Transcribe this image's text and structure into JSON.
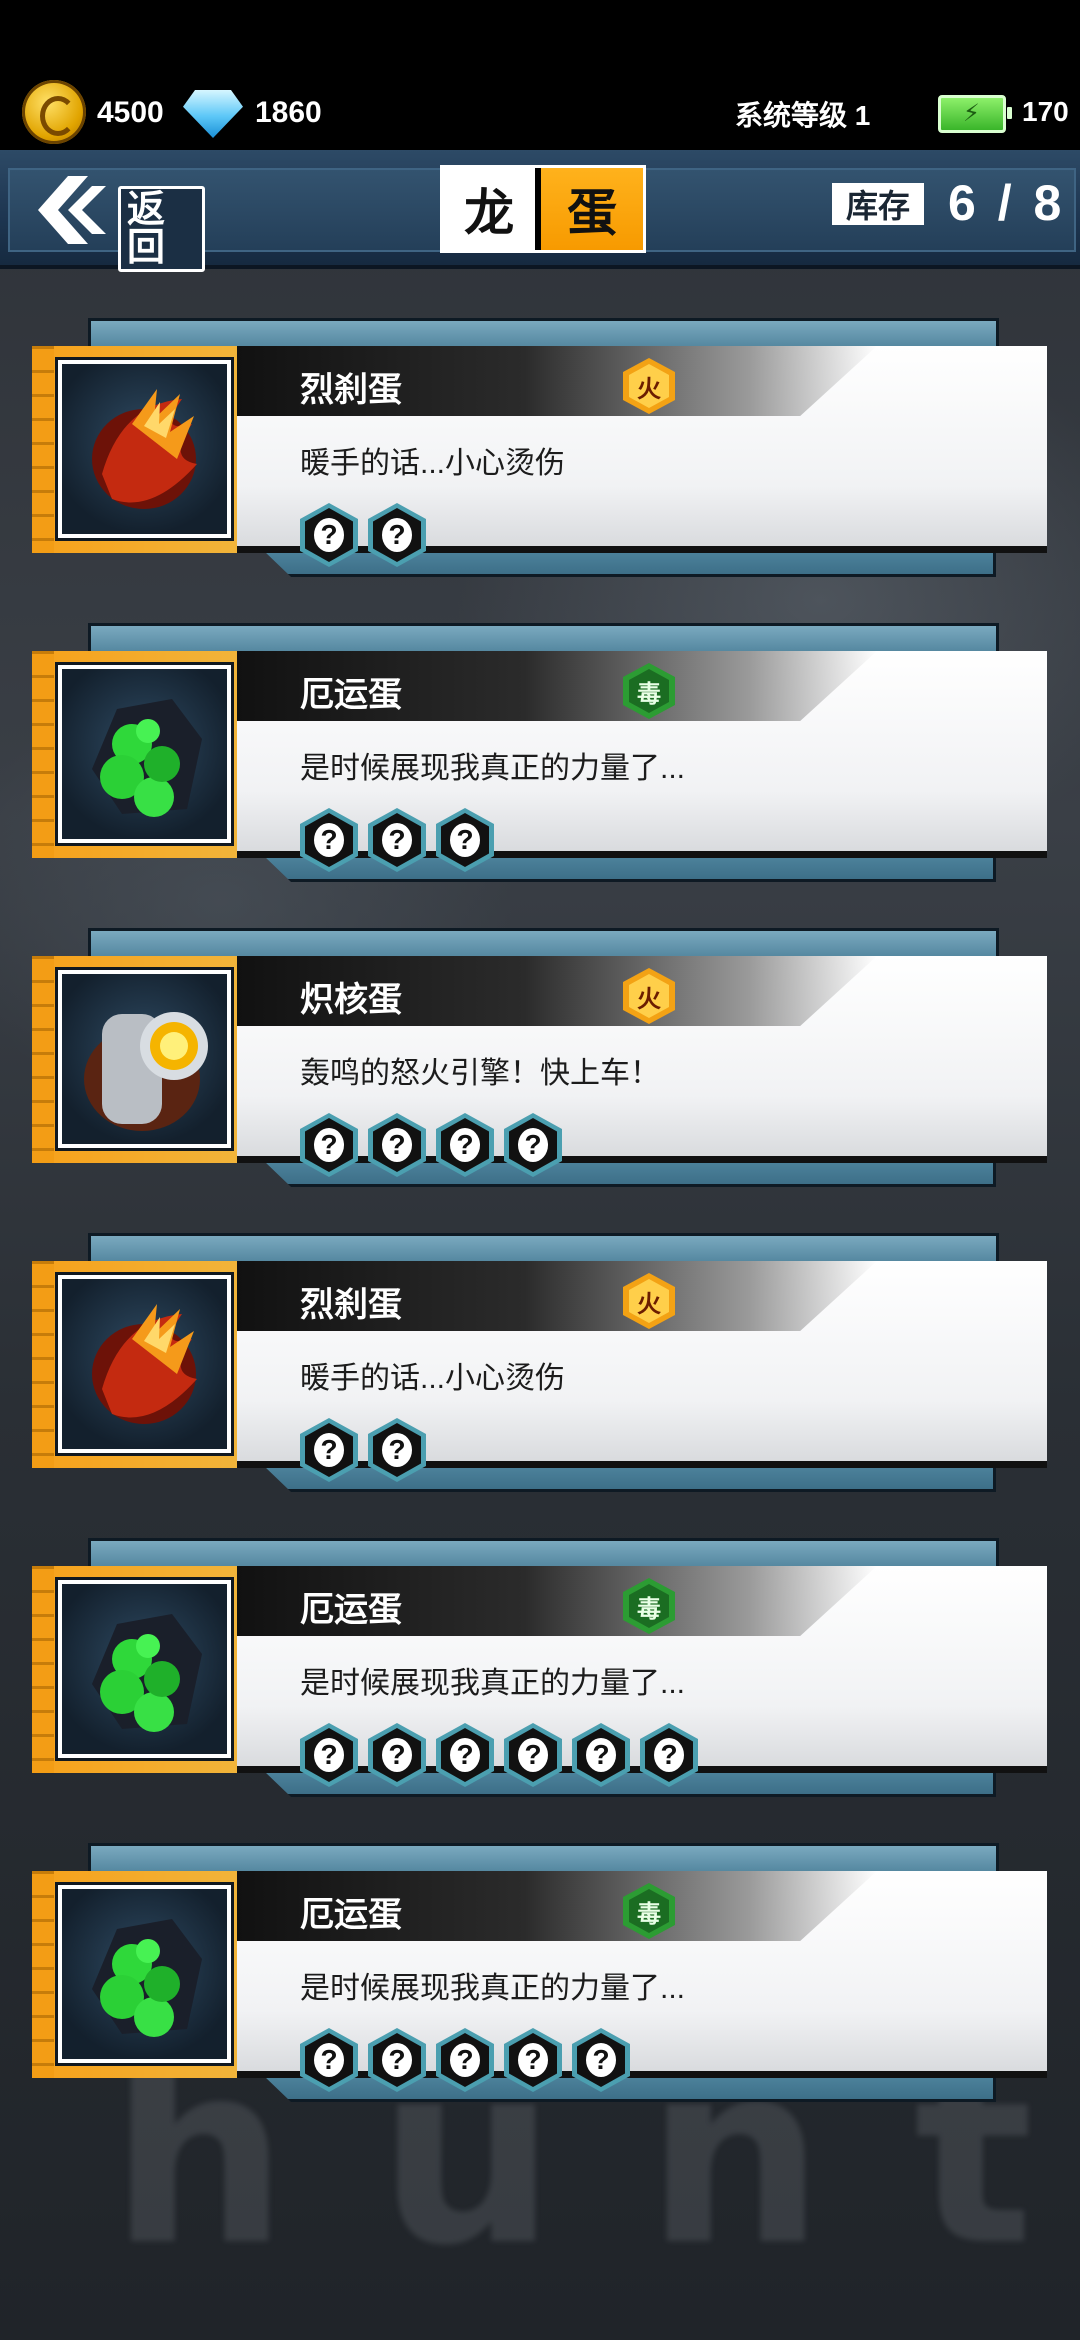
{
  "currency": {
    "coins": "4500",
    "gems": "1860",
    "coin_icon": "gold-coin-icon",
    "gem_icon": "diamond-icon"
  },
  "system": {
    "level_label": "系统等级 1",
    "energy": "170",
    "energy_icon": "battery-energy-icon"
  },
  "header": {
    "back_label": "返回",
    "title_part1": "龙",
    "title_part2": "蛋",
    "stock_label": "库存",
    "stock_value": "6 / 8"
  },
  "eggs": [
    {
      "name": "烈刹蛋",
      "element": "火",
      "element_type": "fire",
      "desc": "暖手的话...小心烫伤",
      "slots": [
        "?",
        "?"
      ],
      "icon": "fire-claw-egg-icon"
    },
    {
      "name": "厄运蛋",
      "element": "毒",
      "element_type": "poison",
      "desc": "是时候展现我真正的力量了...",
      "slots": [
        "?",
        "?",
        "?"
      ],
      "icon": "green-doom-egg-icon"
    },
    {
      "name": "炽核蛋",
      "element": "火",
      "element_type": "fire",
      "desc": "轰鸣的怒火引擎！快上车！",
      "slots": [
        "?",
        "?",
        "?",
        "?"
      ],
      "icon": "engine-core-egg-icon"
    },
    {
      "name": "烈刹蛋",
      "element": "火",
      "element_type": "fire",
      "desc": "暖手的话...小心烫伤",
      "slots": [
        "?",
        "?"
      ],
      "icon": "fire-claw-egg-icon"
    },
    {
      "name": "厄运蛋",
      "element": "毒",
      "element_type": "poison",
      "desc": "是时候展现我真正的力量了...",
      "slots": [
        "?",
        "?",
        "?",
        "?",
        "?",
        "?"
      ],
      "icon": "green-doom-egg-icon"
    },
    {
      "name": "厄运蛋",
      "element": "毒",
      "element_type": "poison",
      "desc": "是时候展现我真正的力量了...",
      "slots": [
        "?",
        "?",
        "?",
        "?",
        "?"
      ],
      "icon": "green-doom-egg-icon"
    }
  ],
  "background": {
    "watermark_text": "hunter"
  },
  "colors": {
    "accent_orange": "#f79a00",
    "header_blue": "#1d3550",
    "slot_teal": "#4b9fb0"
  }
}
